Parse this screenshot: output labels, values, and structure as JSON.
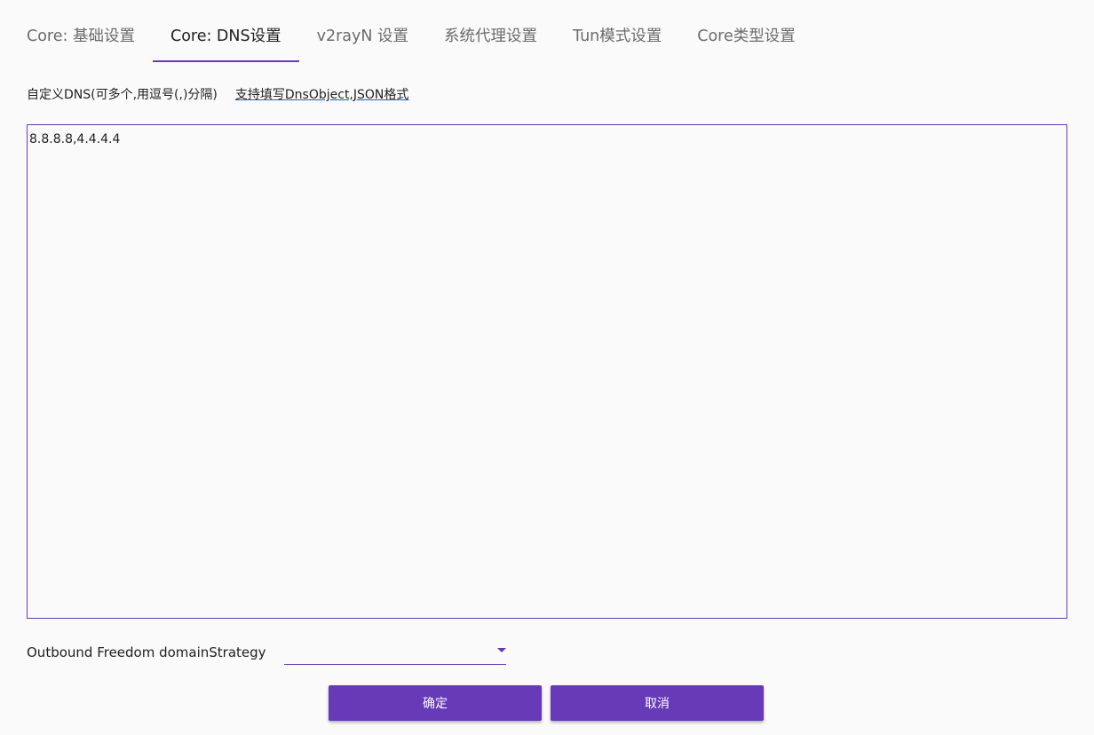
{
  "tabs": [
    {
      "label": "Core: 基础设置",
      "active": false
    },
    {
      "label": "Core: DNS设置",
      "active": true
    },
    {
      "label": "v2rayN 设置",
      "active": false
    },
    {
      "label": "系统代理设置",
      "active": false
    },
    {
      "label": "Tun模式设置",
      "active": false
    },
    {
      "label": "Core类型设置",
      "active": false
    }
  ],
  "dns": {
    "label": "自定义DNS(可多个,用逗号(,)分隔)",
    "help_link": "支持填写DnsObject,JSON格式",
    "value": "8.8.8.8,4.4.4.4"
  },
  "strategy": {
    "label": "Outbound Freedom domainStrategy",
    "selected": ""
  },
  "buttons": {
    "ok": "确定",
    "cancel": "取消"
  },
  "colors": {
    "accent": "#673ab7",
    "background": "#fafafa"
  }
}
